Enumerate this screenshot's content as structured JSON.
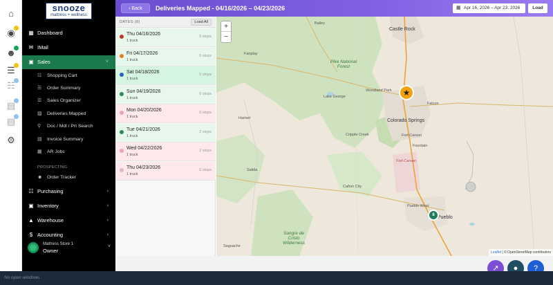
{
  "logo": {
    "main": "snooze",
    "sub": "mattress + wellness"
  },
  "rail": {
    "icons": [
      "home-icon",
      "map-pin-icon",
      "users-icon",
      "checklist-icon",
      "cart-icon",
      "report-icon",
      "report-icon",
      "settings-icon"
    ]
  },
  "sidebar": {
    "items": [
      {
        "label": "Dashboard",
        "icon": "dashboard-icon"
      },
      {
        "label": "IMail",
        "icon": "mail-icon"
      },
      {
        "label": "Sales",
        "icon": "sales-icon",
        "active": true
      }
    ],
    "sales_sub": [
      {
        "label": "Shopping Cart",
        "icon": "cart-icon"
      },
      {
        "label": "Order Summary",
        "icon": "list-icon"
      },
      {
        "label": "Sales Organizer",
        "icon": "list-icon"
      },
      {
        "label": "Deliveries Mapped",
        "icon": "map-icon"
      },
      {
        "label": "Doc / Mdl / Prt Search",
        "icon": "search-icon"
      },
      {
        "label": "Invoice Summary",
        "icon": "invoice-icon"
      },
      {
        "label": "AR Jobs",
        "icon": "table-icon"
      }
    ],
    "prospecting_label": "PROSPECTING",
    "prospecting_sub": [
      {
        "label": "Order Tracker",
        "icon": "people-icon"
      }
    ],
    "bottom_items": [
      {
        "label": "Purchasing",
        "icon": "cart-icon"
      },
      {
        "label": "Inventory",
        "icon": "inventory-icon"
      },
      {
        "label": "Warehouse",
        "icon": "warehouse-icon"
      },
      {
        "label": "Accounting",
        "icon": "dollar-icon"
      }
    ],
    "user": {
      "store": "Mattress Store 1",
      "role": "Owner"
    }
  },
  "header": {
    "back_label": "Back",
    "title": "Deliveries Mapped - 04/16/2026 – 04/23/2026",
    "date_range": "Apr 16, 2026 – Apr 23, 2026",
    "load_label": "Load"
  },
  "dates": {
    "header_label": "DATES (8)",
    "load_all_label": "Load All",
    "rows": [
      {
        "name": "Thu 04/16/2026",
        "trucks": "1 truck",
        "stops": "0 stops",
        "dot": "#c0392b",
        "bg": "#e8f7ec"
      },
      {
        "name": "Fri 04/17/2026",
        "trucks": "1 truck",
        "stops": "0 stops",
        "dot": "#e67e22",
        "bg": "#e8f7ec"
      },
      {
        "name": "Sat 04/18/2026",
        "trucks": "1 truck",
        "stops": "0 stops",
        "dot": "#2c5fc4",
        "bg": "#d6f4e2"
      },
      {
        "name": "Sun 04/19/2026",
        "trucks": "1 truck",
        "stops": "0 stops",
        "dot": "#2e8b57",
        "bg": "#e8f7ec"
      },
      {
        "name": "Mon 04/20/2026",
        "trucks": "1 truck",
        "stops": "0 stops",
        "dot": "#e8a6b8",
        "bg": "#fde8ec"
      },
      {
        "name": "Tue 04/21/2026",
        "trucks": "1 truck",
        "stops": "2 stops",
        "dot": "#2e8b57",
        "bg": "#e8f7ec"
      },
      {
        "name": "Wed 04/22/2026",
        "trucks": "1 truck",
        "stops": "2 stops",
        "dot": "#e8a6b8",
        "bg": "#fde8ec"
      },
      {
        "name": "Thu 04/23/2026",
        "trucks": "1 truck",
        "stops": "0 stops",
        "dot": "#e6b8c6",
        "bg": "#fde8ec"
      }
    ]
  },
  "map": {
    "zoom_in": "+",
    "zoom_out": "−",
    "attribution_leaflet": "Leaflet",
    "attribution_rest": " | © OpenStreetMap contributors",
    "labels": {
      "bailey": "Bailey",
      "castle_rock": "Castle Rock",
      "fairplay": "Fairplay",
      "pike_park": "Pike National Forest",
      "woodland_park": "Woodland Park",
      "lake_george": "Lake George",
      "falcon": "Falcon",
      "colorado_springs": "Colorado Springs",
      "fort_carson": "Fort Carson",
      "fort_carson_area": "Fort Carson",
      "fountain": "Fountain",
      "cripple_creek": "Cripple Creek",
      "hartsel": "Hartsel",
      "salida": "Salida",
      "canon_city": "Cañon City",
      "pueblo_west": "Pueblo West",
      "pueblo": "Pueblo",
      "sangre": "Sangre de Cristo Wilderness",
      "saguache": "Saguache"
    },
    "marker_number": "8",
    "marker_star": "★"
  },
  "colors": {
    "header_start": "#6a4ed0",
    "active_nav": "#1b7a4b",
    "fab_purple": "#7a4fd6",
    "fab_teal": "#1f4e63",
    "fab_blue": "#1f5fd6"
  },
  "taskbar": {
    "text": "No open windows"
  }
}
